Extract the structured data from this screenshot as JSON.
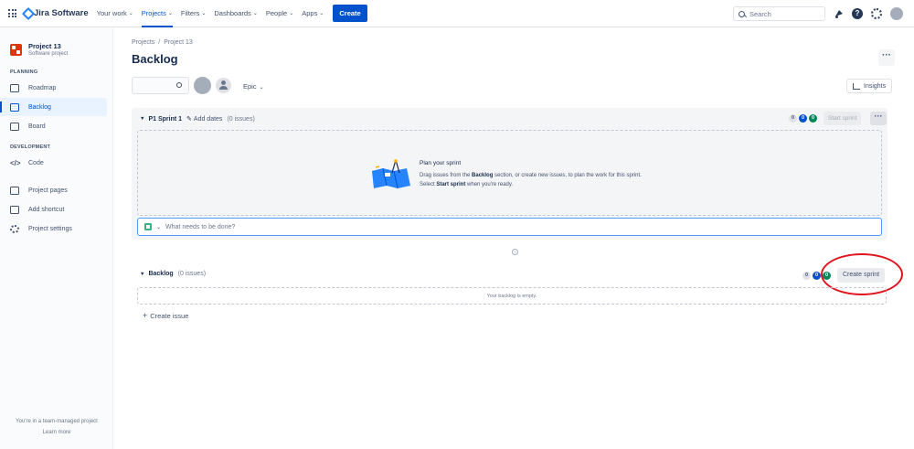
{
  "topnav": {
    "app_name": "Jira Software",
    "items": [
      {
        "label": "Your work"
      },
      {
        "label": "Projects"
      },
      {
        "label": "Filters"
      },
      {
        "label": "Dashboards"
      },
      {
        "label": "People"
      },
      {
        "label": "Apps"
      }
    ],
    "create_label": "Create",
    "search_placeholder": "Search",
    "help_glyph": "?"
  },
  "sidebar": {
    "project_name": "Project 13",
    "project_type": "Software project",
    "planning_title": "PLANNING",
    "planning_items": [
      {
        "label": "Roadmap",
        "icon": "roadmap-icon"
      },
      {
        "label": "Backlog",
        "icon": "backlog-icon"
      },
      {
        "label": "Board",
        "icon": "board-icon"
      }
    ],
    "development_title": "DEVELOPMENT",
    "code_label": "Code",
    "other_items": [
      {
        "label": "Project pages"
      },
      {
        "label": "Add shortcut"
      },
      {
        "label": "Project settings"
      }
    ],
    "footer_text": "You're in a team-managed project",
    "learn_more": "Learn more"
  },
  "main": {
    "breadcrumb": [
      "Projects",
      "Project 13"
    ],
    "breadcrumb_sep": "/",
    "title": "Backlog",
    "more_glyph": "···",
    "epic_label": "Epic",
    "insights_label": "Insights"
  },
  "sprint": {
    "name": "P1 Sprint 1",
    "add_dates": "Add dates",
    "issue_count": "(0 issues)",
    "badges": [
      "0",
      "0",
      "0"
    ],
    "start_label": "Start sprint",
    "plan_title": "Plan your sprint",
    "plan_desc_1": "Drag issues from the ",
    "plan_desc_backlog": "Backlog",
    "plan_desc_2": " section, or create new issues, to plan the work for this sprint. Select ",
    "plan_desc_start": "Start sprint",
    "plan_desc_3": " when you're ready.",
    "create_placeholder": "What needs to be done?"
  },
  "backlog": {
    "name": "Backlog",
    "issue_count": "(0 issues)",
    "badges": [
      "0",
      "0",
      "0"
    ],
    "create_sprint_label": "Create sprint",
    "empty_text": "Your backlog is empty.",
    "create_issue_label": "Create issue"
  },
  "colors": {
    "brand": "#0052cc",
    "annotation": "#e0141e"
  }
}
